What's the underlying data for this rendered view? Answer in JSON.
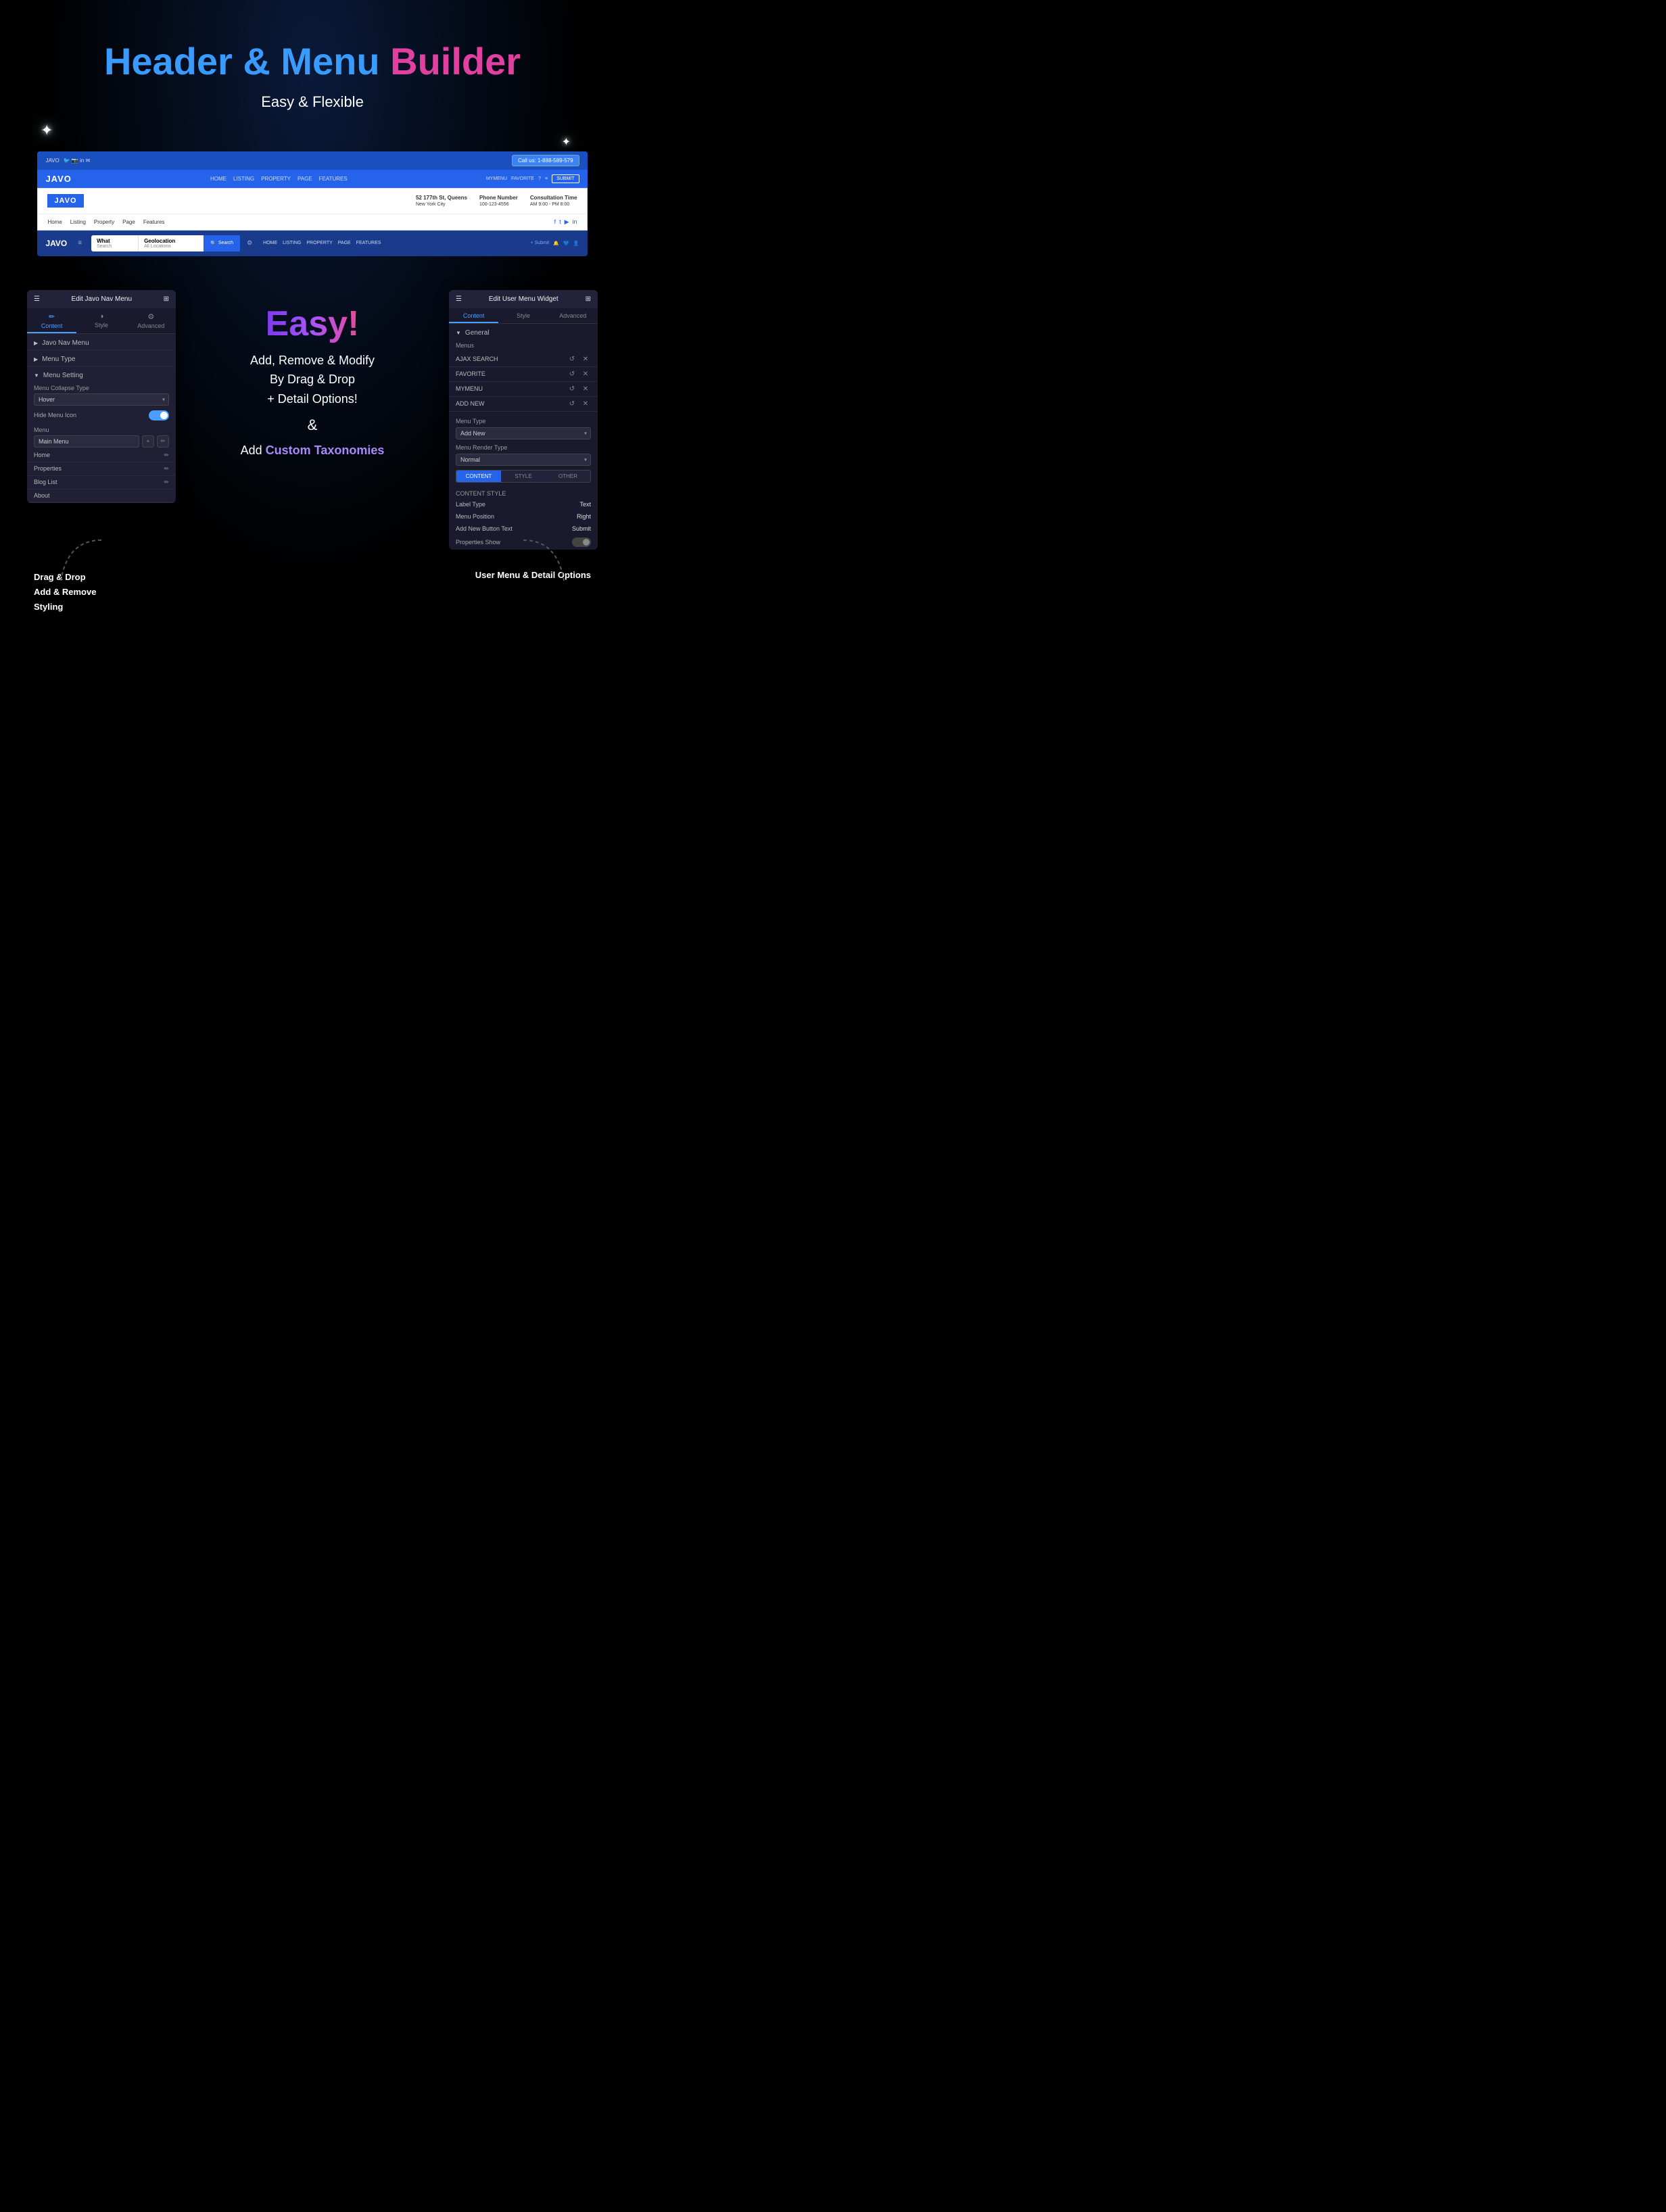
{
  "hero": {
    "title_blue": "Header & Menu",
    "title_pink": "Builder",
    "subtitle": "Easy & Flexible"
  },
  "preview1": {
    "logo": "JAVO",
    "links": [
      "HOME",
      "LISTING",
      "PROPERTY",
      "PAGE",
      "FEATURES"
    ],
    "actions": [
      "MYMENU",
      "FAVORITE",
      "?",
      "≡",
      "SUBMIT"
    ],
    "phone": "Call us: 1-888-589-579"
  },
  "preview2": {
    "logo": "JAVO",
    "address_label": "52 177th St, Queens",
    "address_sub": "New York City",
    "phone_label": "Phone Number",
    "phone_val": "100-123-4556",
    "time_label": "Consultation Time",
    "time_val": "AM 9:00 - PM 8:00",
    "links": [
      "Home",
      "Listing",
      "Property",
      "Page",
      "Features"
    ],
    "social": [
      "f",
      "t",
      "▶",
      "in"
    ]
  },
  "preview3": {
    "logo": "JAVO",
    "search_what": "What",
    "search_what_sub": "Search",
    "search_geo": "Geolocation",
    "search_geo_sub": "All Locations",
    "search_btn": "Search",
    "nav_links": [
      "HOME",
      "LISTING",
      "PROPERTY",
      "PAGE",
      "FEATURES"
    ],
    "submit": "+ Submit"
  },
  "left_panel": {
    "title": "Edit Javo Nav Menu",
    "tabs": [
      {
        "label": "Content",
        "icon": "✏️",
        "active": true
      },
      {
        "label": "Style",
        "icon": "◑",
        "active": false
      },
      {
        "label": "Advanced",
        "icon": "⚙",
        "active": false
      }
    ],
    "sections": [
      {
        "label": "Javo Nav Menu",
        "collapsed": true
      },
      {
        "label": "Menu Type",
        "collapsed": true
      },
      {
        "label": "Menu Setting",
        "collapsed": false
      }
    ],
    "menu_collapse_label": "Menu Collapse Type",
    "menu_collapse_value": "Hover",
    "hide_menu_label": "Hide Menu Icon",
    "menu_label": "Menu",
    "menu_value": "Main Menu",
    "menu_items": [
      "Home",
      "Properties",
      "Blog List",
      "About"
    ],
    "show_edit": true
  },
  "right_panel": {
    "title": "Edit User Menu Widget",
    "tabs": [
      {
        "label": "Content",
        "active": true
      },
      {
        "label": "Style",
        "active": false
      },
      {
        "label": "Advanced",
        "active": false
      }
    ],
    "general_label": "General",
    "menus_label": "Menus",
    "menu_items": [
      {
        "name": "AJAX SEARCH"
      },
      {
        "name": "FAVORITE"
      },
      {
        "name": "MYMENU"
      },
      {
        "name": "ADD NEW"
      }
    ],
    "menu_type_label": "Menu Type",
    "menu_type_value": "Add New",
    "menu_render_label": "Menu Render Type",
    "menu_render_value": "Normal",
    "content_tabs": [
      "CONTENT",
      "STYLE",
      "OTHER"
    ],
    "label_type_label": "Label Type",
    "label_type_value": "Text",
    "menu_position_label": "Menu Position",
    "menu_position_value": "Right",
    "add_new_button_label": "Add New Button Text",
    "add_new_button_value": "Submit",
    "properties_show_label": "Properties Show",
    "content_style_label": "CONTENT STYLE",
    "normal_label": "Normal"
  },
  "center": {
    "easy_label": "Easy!",
    "desc_line1": "Add, Remove & Modify",
    "desc_line2": "By Drag & Drop",
    "desc_line3": "+ Detail Options!",
    "amp": "&",
    "desc_line4": "Add ",
    "custom_tax": "Custom Taxonomies"
  },
  "labels": {
    "left_bottom": "Drag & Drop\nAdd & Remove\nStyling",
    "right_bottom": "User Menu & Detail Options"
  }
}
